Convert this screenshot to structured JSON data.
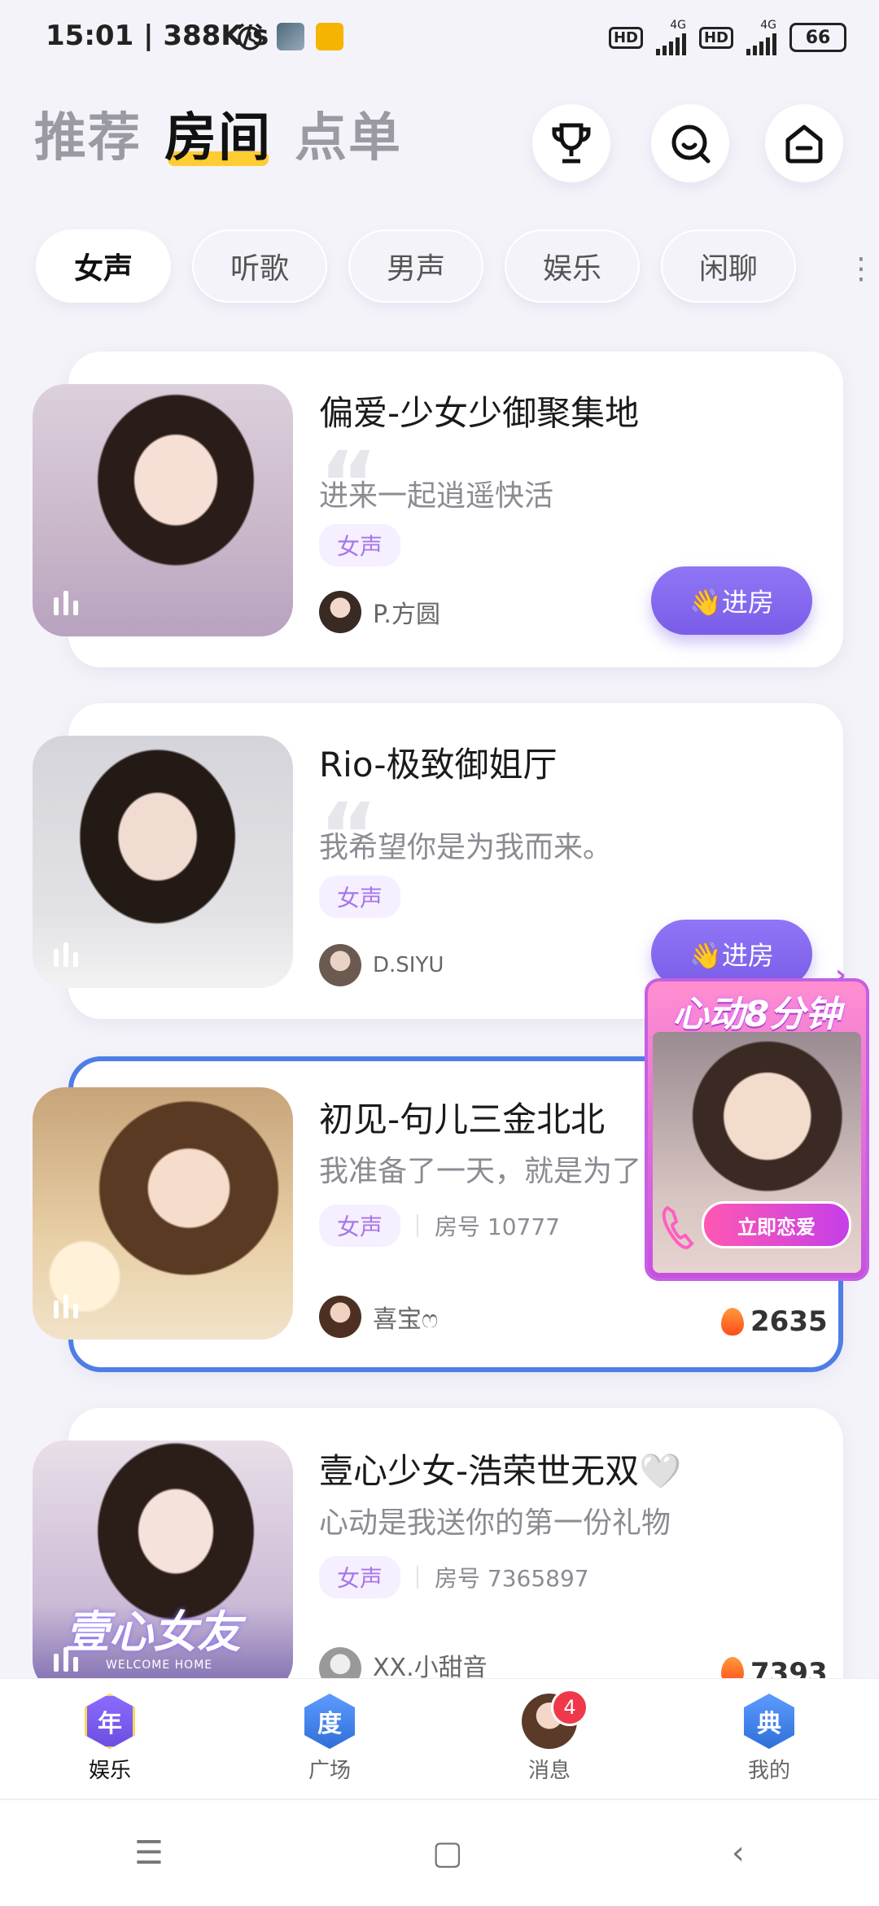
{
  "status": {
    "time_speed": "15:01 | 388K/s",
    "network_1": "4G",
    "network_2": "4G",
    "hd_1": "HD",
    "hd_2": "HD",
    "battery": "66"
  },
  "top_nav": {
    "tabs": [
      "推荐",
      "房间",
      "点单"
    ],
    "active_index": 1,
    "icons": [
      "trophy-icon",
      "search-icon",
      "home-icon"
    ]
  },
  "categories": {
    "items": [
      "女声",
      "听歌",
      "男声",
      "娱乐",
      "闲聊"
    ],
    "active_index": 0,
    "more": "⋮"
  },
  "rooms": [
    {
      "title": "偏爱-少女少御聚集地",
      "desc": "进来一起逍遥快活",
      "tag": "女声",
      "room_no": "",
      "host": "P.方圆",
      "action": "👋进房",
      "hot": ""
    },
    {
      "title": "Rio-极致御姐厅",
      "desc": "我希望你是为我而来。",
      "tag": "女声",
      "room_no": "",
      "host": "D.SIYU",
      "action": "👋进房",
      "hot": ""
    },
    {
      "title": "初见-句儿三金北北",
      "desc": "我准备了一天，就是为了",
      "tag": "女声",
      "room_no": "房号 10777",
      "host": "喜宝ෆ",
      "action": "",
      "hot": "2635"
    },
    {
      "title": "壹心少女-浩荣世无双🤍",
      "desc": "心动是我送你的第一份礼物",
      "tag": "女声",
      "room_no": "房号 7365897",
      "host": "XX.小甜音",
      "action": "",
      "hot": "7393",
      "photo_text": "壹心女友",
      "photo_sub": "WELCOME HOME"
    }
  ],
  "promo": {
    "title": "心动8分钟",
    "button": "立即恋爱",
    "close": "›"
  },
  "tabbar": {
    "items": [
      {
        "label": "娱乐",
        "glyph": "年",
        "color": "#7b5cf0"
      },
      {
        "label": "广场",
        "glyph": "度",
        "color": "#3d7fe6"
      },
      {
        "label": "消息",
        "glyph": "",
        "color": "#d7a090",
        "badge": "4"
      },
      {
        "label": "我的",
        "glyph": "典",
        "color": "#3d7fe6"
      }
    ],
    "active_index": 0
  },
  "system_nav": {
    "menu": "☰",
    "home": "▢",
    "back": "‹"
  }
}
